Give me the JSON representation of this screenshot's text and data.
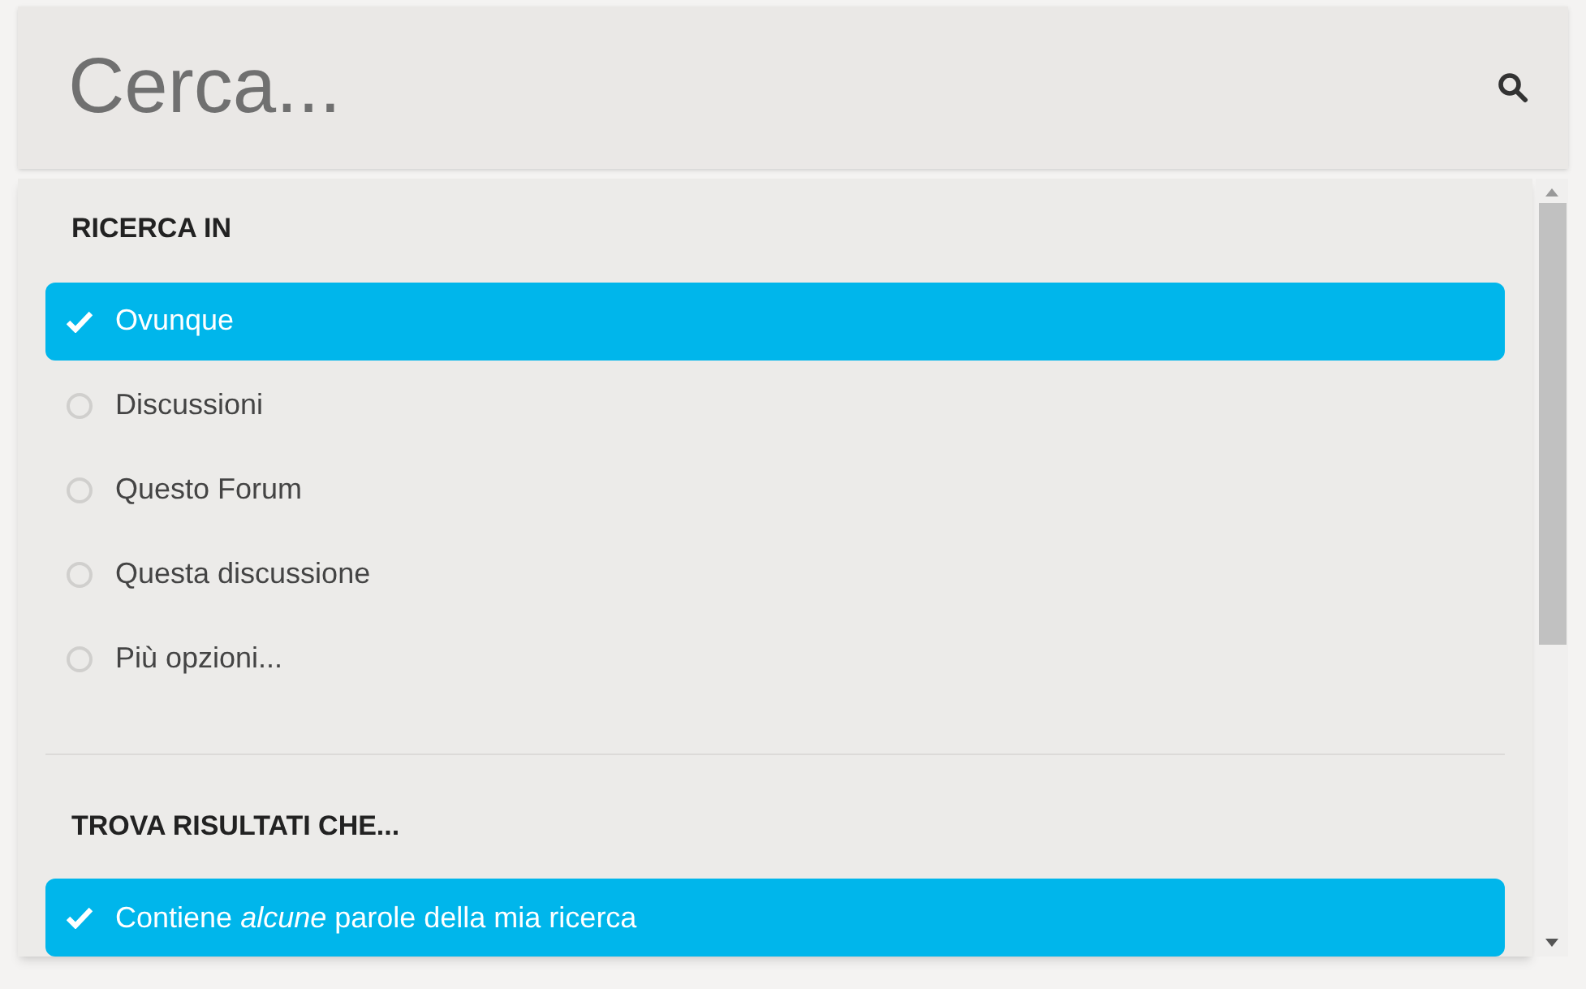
{
  "search": {
    "placeholder": "Cerca..."
  },
  "sections": [
    {
      "heading": "RICERCA IN",
      "options": [
        {
          "label": "Ovunque",
          "selected": true
        },
        {
          "label": "Discussioni",
          "selected": false
        },
        {
          "label": "Questo Forum",
          "selected": false
        },
        {
          "label": "Questa discussione",
          "selected": false
        },
        {
          "label": "Più opzioni...",
          "selected": false
        }
      ]
    },
    {
      "heading": "TROVA RISULTATI CHE...",
      "options": [
        {
          "label": "Contiene *alcune* parole della mia ricerca",
          "selected": true
        }
      ]
    }
  ]
}
